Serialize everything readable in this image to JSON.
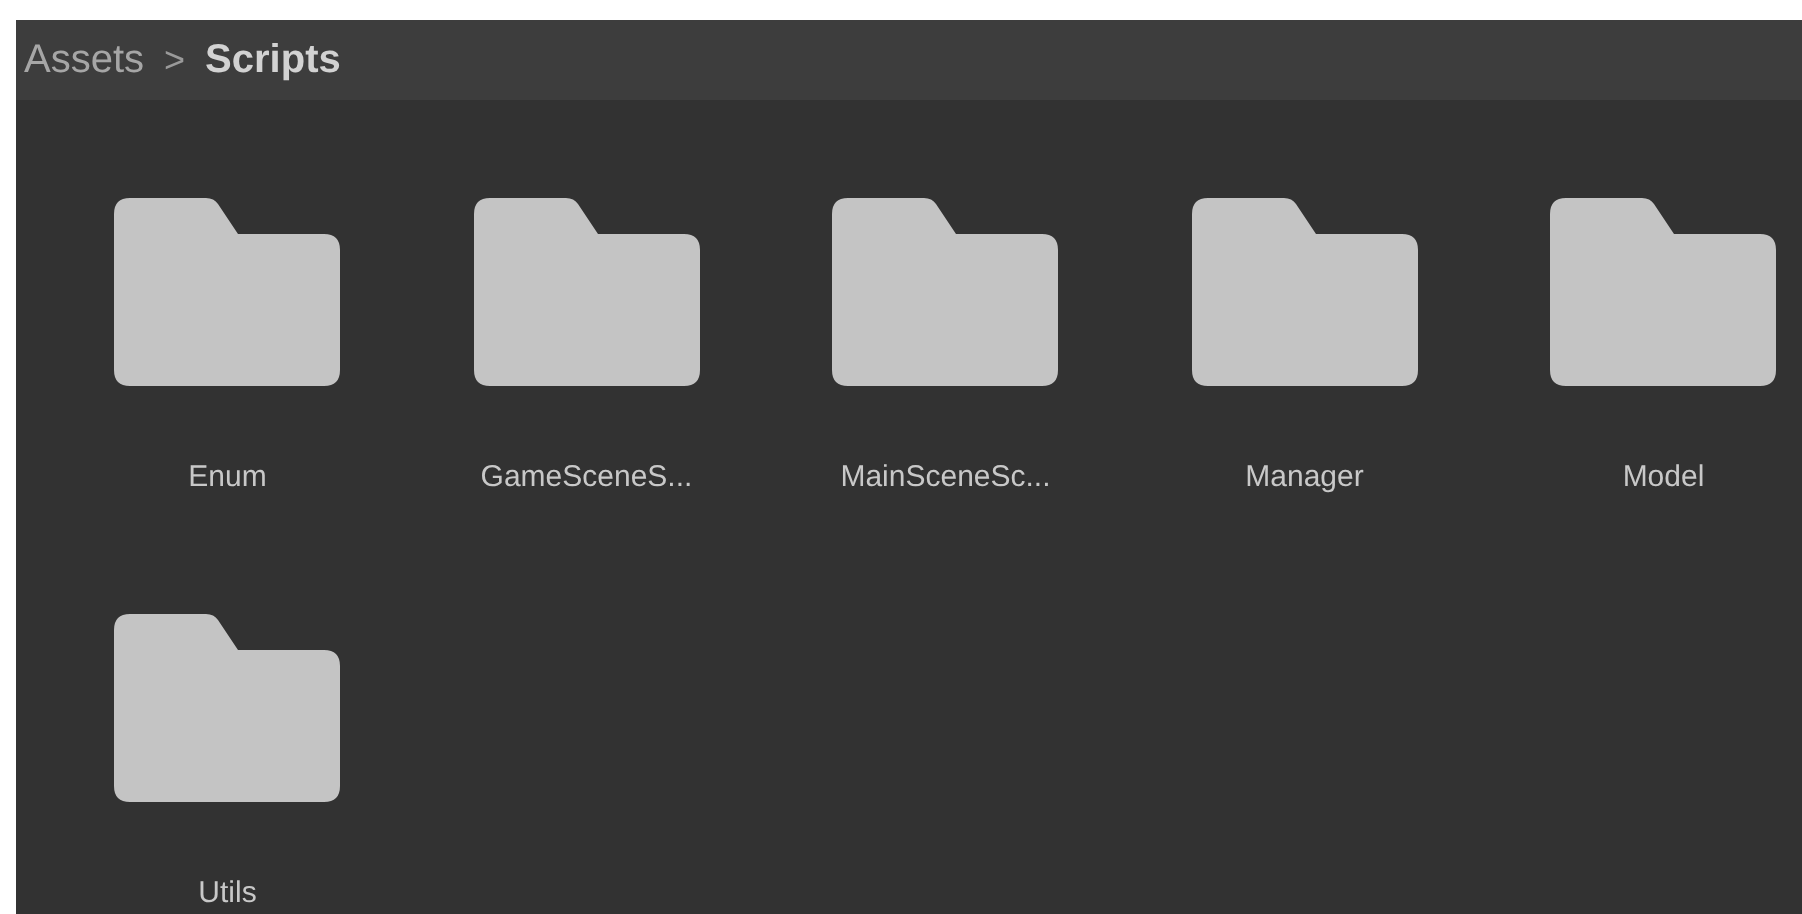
{
  "breadcrumb": [
    {
      "label": "Assets",
      "current": false
    },
    {
      "label": "Scripts",
      "current": true
    }
  ],
  "separator": ">",
  "folders": [
    {
      "name": "Enum"
    },
    {
      "name": "GameSceneS..."
    },
    {
      "name": "MainSceneSc..."
    },
    {
      "name": "Manager"
    },
    {
      "name": "Model"
    },
    {
      "name": "Utils"
    }
  ]
}
